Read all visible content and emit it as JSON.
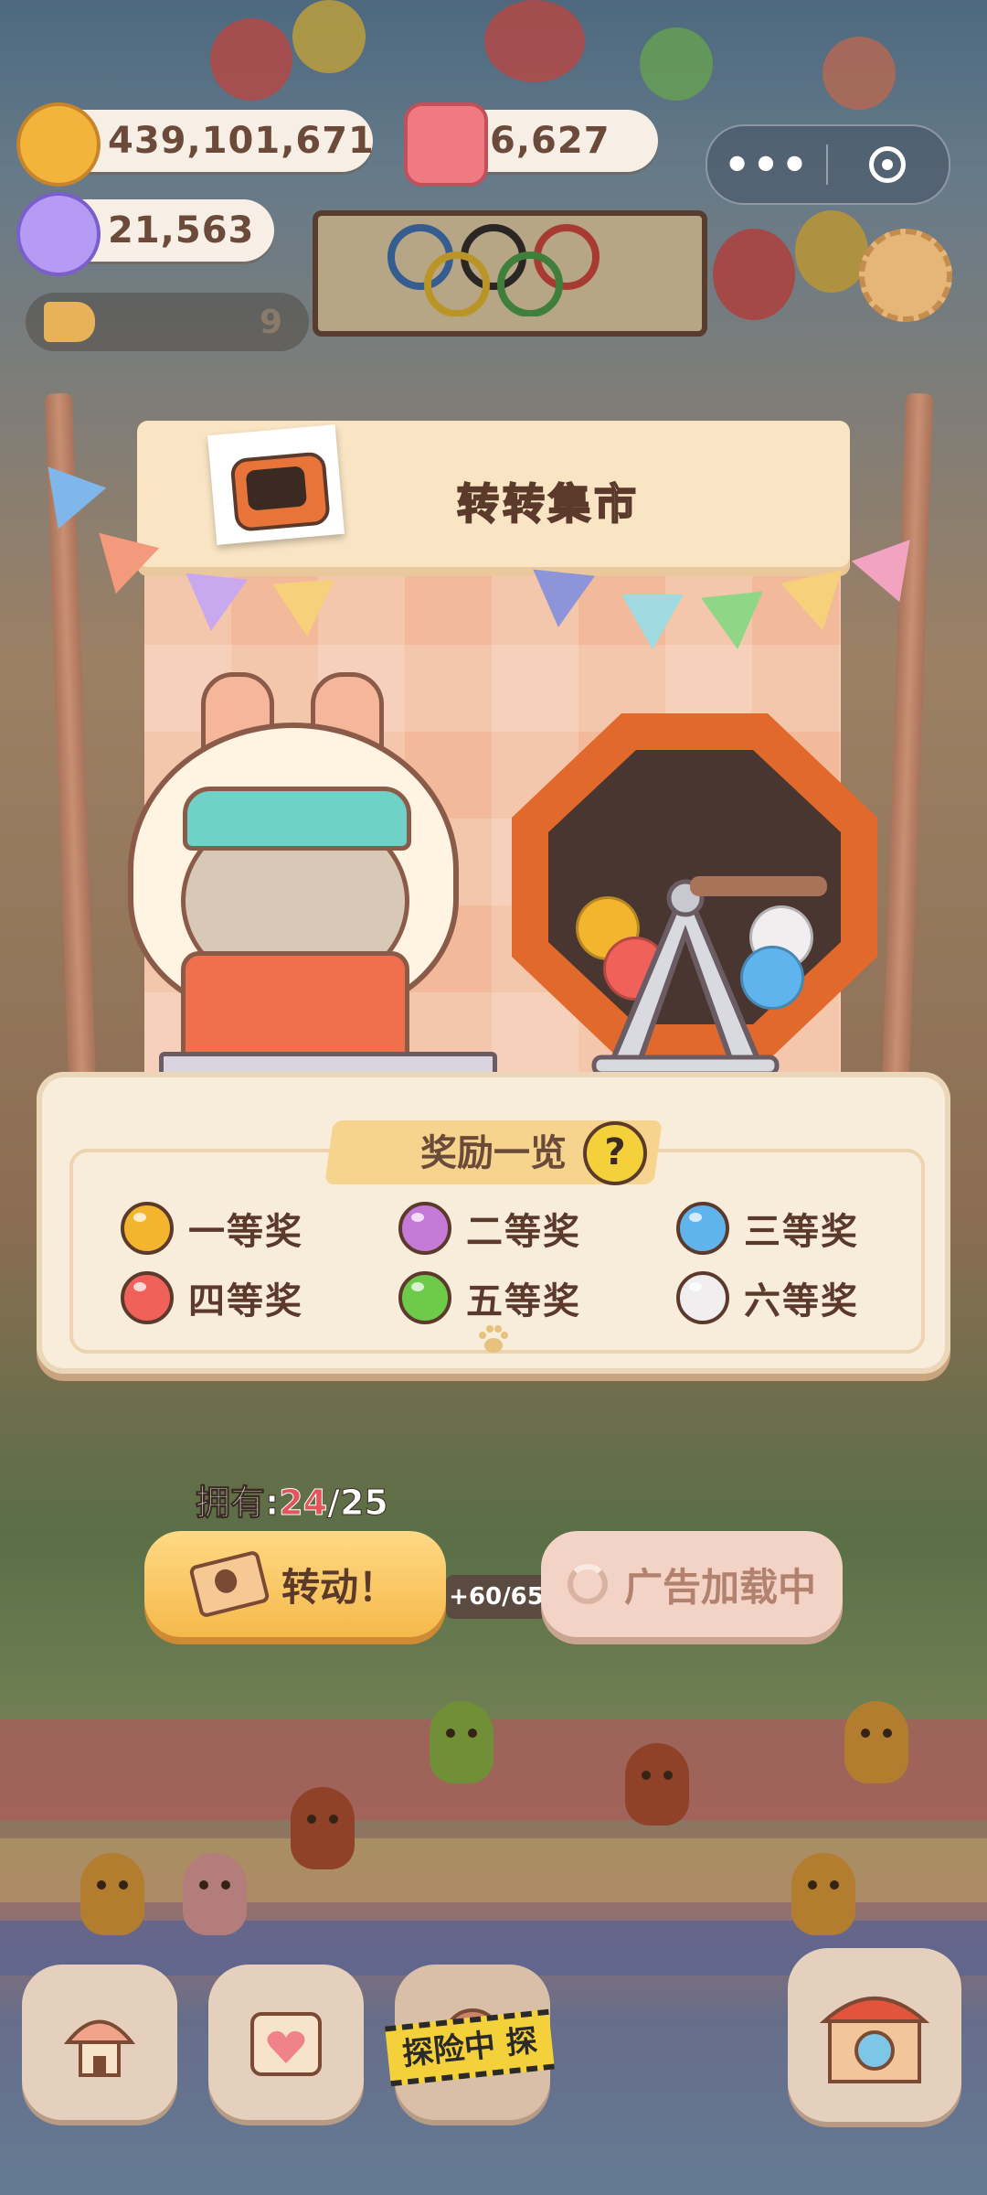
{
  "hud": {
    "coins": "439,101,671",
    "gems": "6,627",
    "crystals": "21,563",
    "announce_count": "9",
    "menu_icon": "more-dots-icon",
    "close_icon": "target-close-icon"
  },
  "stall": {
    "title": "转转集市"
  },
  "rewards": {
    "heading": "奖励一览",
    "help": "?",
    "tiers": [
      {
        "label": "一等奖",
        "color": "#f3b52e"
      },
      {
        "label": "二等奖",
        "color": "#c67ad8"
      },
      {
        "label": "三等奖",
        "color": "#5fb4ee"
      },
      {
        "label": "四等奖",
        "color": "#f0615a"
      },
      {
        "label": "五等奖",
        "color": "#6ecb4a"
      },
      {
        "label": "六等奖",
        "color": "#f1eef0"
      }
    ]
  },
  "owned": {
    "prefix": "拥有:",
    "current": "24",
    "sep": "/",
    "max": "25"
  },
  "actions": {
    "spin_label": "转动！",
    "ad_label": "广告加载中"
  },
  "energy": "+60/65",
  "nav": {
    "adventure_label": "探险中 探险中"
  },
  "colors": {
    "accent": "#f5b94a",
    "wheel": "#e2692c",
    "count_highlight": "#e2555a"
  }
}
